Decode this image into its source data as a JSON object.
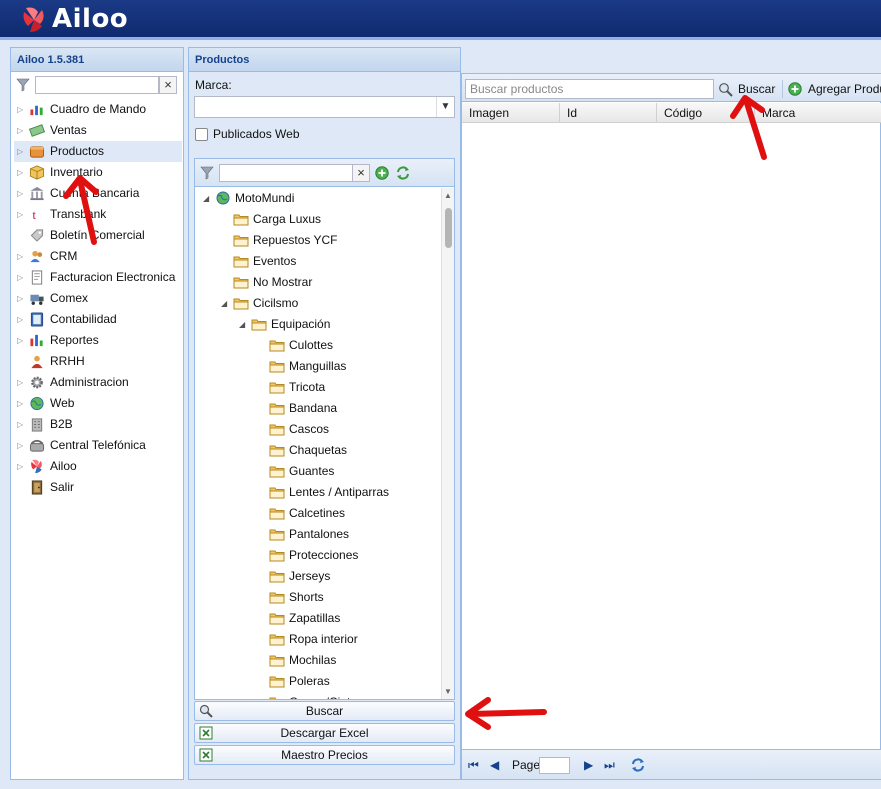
{
  "app": {
    "brand": "Ailoo",
    "version": "Ailoo 1.5.381"
  },
  "nav": {
    "items": [
      {
        "label": "Cuadro de Mando",
        "icon": "chart-icon",
        "expandable": true
      },
      {
        "label": "Ventas",
        "icon": "money-icon",
        "expandable": true
      },
      {
        "label": "Productos",
        "icon": "box-icon",
        "expandable": true,
        "selected": true
      },
      {
        "label": "Inventario",
        "icon": "package-icon",
        "expandable": true
      },
      {
        "label": "Cuenta Bancaria",
        "icon": "bank-icon",
        "expandable": true
      },
      {
        "label": "Transbank",
        "icon": "transbank-icon",
        "expandable": true
      },
      {
        "label": "Boletín Comercial",
        "icon": "tag-icon",
        "expandable": false
      },
      {
        "label": "CRM",
        "icon": "users-icon",
        "expandable": true
      },
      {
        "label": "Facturacion Electronica",
        "icon": "invoice-icon",
        "expandable": true
      },
      {
        "label": "Comex",
        "icon": "truck-icon",
        "expandable": true
      },
      {
        "label": "Contabilidad",
        "icon": "ledger-icon",
        "expandable": true
      },
      {
        "label": "Reportes",
        "icon": "report-icon",
        "expandable": true
      },
      {
        "label": "RRHH",
        "icon": "person-icon",
        "expandable": false
      },
      {
        "label": "Administracion",
        "icon": "gear-icon",
        "expandable": true
      },
      {
        "label": "Web",
        "icon": "globe-icon",
        "expandable": true
      },
      {
        "label": "B2B",
        "icon": "building-icon",
        "expandable": true
      },
      {
        "label": "Central Telefónica",
        "icon": "phone-icon",
        "expandable": true
      },
      {
        "label": "Ailoo",
        "icon": "ailoo-logo-icon",
        "expandable": true
      },
      {
        "label": "Salir",
        "icon": "door-icon",
        "expandable": false
      }
    ]
  },
  "products": {
    "title": "Productos",
    "marca_label": "Marca:",
    "marca_value": "",
    "publicados_label": "Publicados Web",
    "tree": [
      {
        "label": "MotoMundi",
        "level": 0,
        "expanded": true,
        "root": true
      },
      {
        "label": "Carga Luxus",
        "level": 1
      },
      {
        "label": "Repuestos YCF",
        "level": 1
      },
      {
        "label": "Eventos",
        "level": 1
      },
      {
        "label": "No Mostrar",
        "level": 1
      },
      {
        "label": "Cicilsmo",
        "level": 1,
        "expanded": true
      },
      {
        "label": "Equipación",
        "level": 2,
        "expanded": true
      },
      {
        "label": "Culottes",
        "level": 3
      },
      {
        "label": "Manguillas",
        "level": 3
      },
      {
        "label": "Tricota",
        "level": 3
      },
      {
        "label": "Bandana",
        "level": 3
      },
      {
        "label": "Cascos",
        "level": 3
      },
      {
        "label": "Chaquetas",
        "level": 3
      },
      {
        "label": "Guantes",
        "level": 3
      },
      {
        "label": "Lentes / Antiparras",
        "level": 3
      },
      {
        "label": "Calcetines",
        "level": 3
      },
      {
        "label": "Pantalones",
        "level": 3
      },
      {
        "label": "Protecciones",
        "level": 3
      },
      {
        "label": "Jerseys",
        "level": 3
      },
      {
        "label": "Shorts",
        "level": 3
      },
      {
        "label": "Zapatillas",
        "level": 3
      },
      {
        "label": "Ropa interior",
        "level": 3
      },
      {
        "label": "Mochilas",
        "level": 3
      },
      {
        "label": "Poleras",
        "level": 3
      },
      {
        "label": "Gorras/Cintas",
        "level": 3
      }
    ],
    "buttons": {
      "buscar": "Buscar",
      "excel": "Descargar Excel",
      "maestro": "Maestro Precios"
    }
  },
  "grid": {
    "search_placeholder": "Buscar productos",
    "search_button": "Buscar",
    "add_button": "Agregar Producto",
    "columns": [
      "Imagen",
      "Id",
      "Código",
      "Marca"
    ],
    "pager_label": "Page"
  },
  "colors": {
    "header": "#0f2a6e",
    "panel_border": "#99bbe8",
    "panel_title": "#15428b",
    "annotation_arrow": "#e01010"
  }
}
